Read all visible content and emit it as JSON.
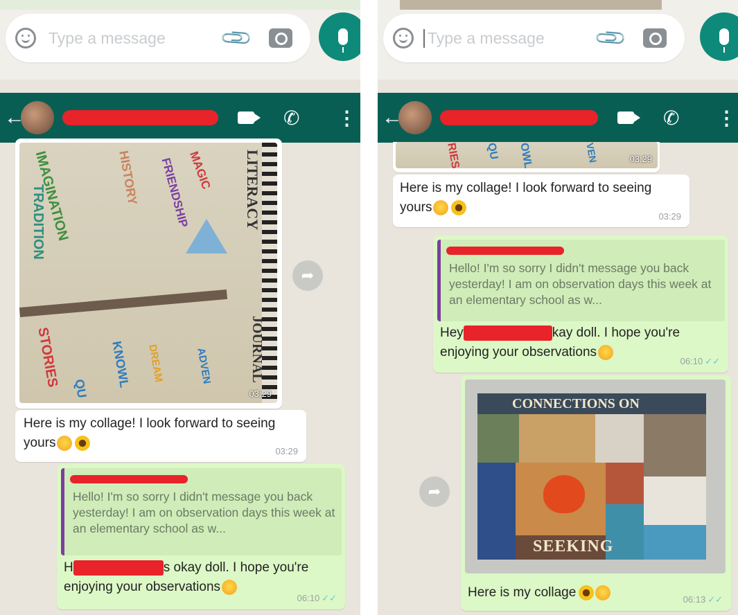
{
  "composer": {
    "placeholder": "Type a message"
  },
  "left": {
    "image_words": [
      "IMAGINATION",
      "TRADITION",
      "HISTORY",
      "FRIENDSHIP",
      "MAGIC",
      "LITERACY",
      "JOURNAL",
      "STORIES",
      "KNOWL",
      "QU",
      "ADVEN",
      "DREAM"
    ],
    "image_time": "03:29",
    "incoming": {
      "text": "Here is my collage! I look forward to seeing yours",
      "time": "03:29"
    },
    "reply": {
      "quote_text": "Hello! I'm so sorry I didn't message you back yesterday! I am on observation days this week at an elementary school as w...",
      "text_prefix": "H",
      "text_after": "s okay doll. I hope you're enjoying your observations",
      "time": "06:10"
    }
  },
  "right": {
    "image_words": [
      "RIES",
      "QU",
      "OWL",
      "VEN"
    ],
    "image_time": "03:29",
    "incoming": {
      "text": "Here is my collage! I look forward to seeing yours",
      "time": "03:29"
    },
    "reply": {
      "quote_text": "Hello! I'm so sorry I didn't message you back yesterday! I am on observation days this week at an elementary school as w...",
      "text_prefix": "Hey",
      "text_after": "kay doll. I hope you're enjoying your observations",
      "time": "06:10"
    },
    "collage_title": "CONNECTIONS ON",
    "collage_word": "SEEKING",
    "caption": {
      "text": "Here is my collage",
      "time": "06:13"
    }
  }
}
